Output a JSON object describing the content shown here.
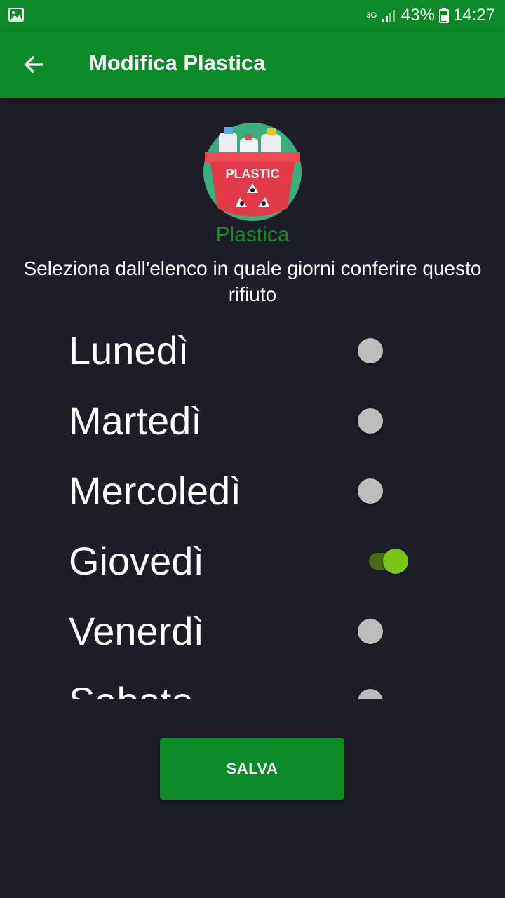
{
  "status_bar": {
    "network_type": "3G",
    "battery_percent": "43%",
    "time": "14:27"
  },
  "app_bar": {
    "title": "Modifica Plastica",
    "back_icon": "arrow-left-icon"
  },
  "header": {
    "logo_text": "PLASTIC",
    "category_name": "Plastica",
    "instructions": "Seleziona dall'elenco in quale giorni conferire questo rifiuto"
  },
  "days": [
    {
      "label": "Lunedì",
      "checked": false
    },
    {
      "label": "Martedì",
      "checked": false
    },
    {
      "label": "Mercoledì",
      "checked": false
    },
    {
      "label": "Giovedì",
      "checked": true
    },
    {
      "label": "Venerdì",
      "checked": false
    },
    {
      "label": "Sabato",
      "checked": false
    }
  ],
  "actions": {
    "save_label": "SALVA"
  },
  "colors": {
    "primary": "#0b8a26",
    "background": "#1c1d26",
    "switch_on": "#7cc414",
    "switch_off": "#bdbdbd",
    "category_text": "#1a8a2c"
  }
}
